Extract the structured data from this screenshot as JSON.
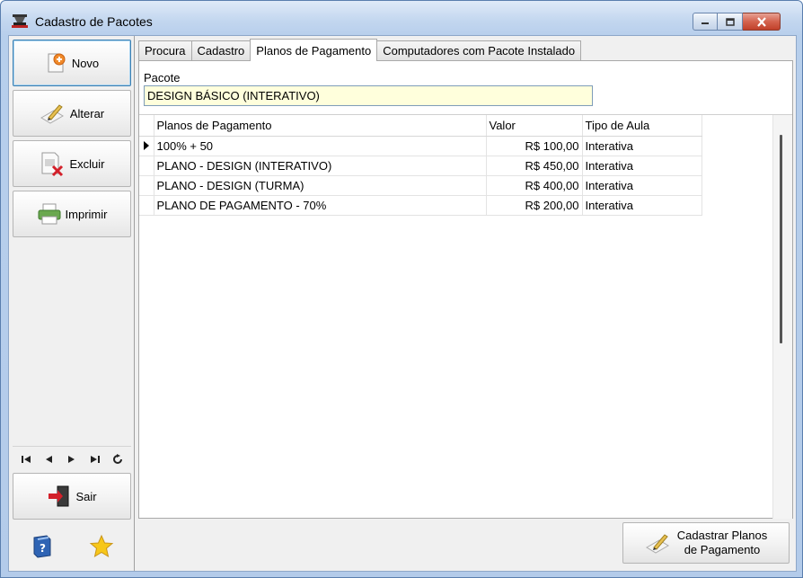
{
  "window": {
    "title": "Cadastro de Pacotes"
  },
  "sidebar": {
    "buttons": [
      {
        "label": "Novo",
        "icon": "new-document-icon"
      },
      {
        "label": "Alterar",
        "icon": "edit-pen-icon"
      },
      {
        "label": "Excluir",
        "icon": "delete-document-icon"
      },
      {
        "label": "Imprimir",
        "icon": "printer-icon"
      }
    ],
    "exit_label": "Sair",
    "nav_icons": [
      "first-record-icon",
      "previous-record-icon",
      "next-record-icon",
      "last-record-icon",
      "refresh-icon"
    ],
    "bottom_icons": [
      "help-book-icon",
      "favorite-star-icon"
    ]
  },
  "tabs": [
    {
      "label": "Procura"
    },
    {
      "label": "Cadastro"
    },
    {
      "label": "Planos de Pagamento",
      "selected": true
    },
    {
      "label": "Computadores com Pacote Instalado"
    }
  ],
  "form": {
    "pacote_label": "Pacote",
    "pacote_value": "DESIGN BÁSICO (INTERATIVO)"
  },
  "grid": {
    "columns": [
      "Planos de Pagamento",
      "Valor",
      "Tipo de Aula"
    ],
    "rows": [
      {
        "plano": "100% + 50",
        "valor": "R$ 100,00",
        "tipo": "Interativa",
        "current": true
      },
      {
        "plano": "PLANO - DESIGN (INTERATIVO)",
        "valor": "R$ 450,00",
        "tipo": "Interativa"
      },
      {
        "plano": "PLANO - DESIGN (TURMA)",
        "valor": "R$ 400,00",
        "tipo": "Interativa"
      },
      {
        "plano": "PLANO DE PAGAMENTO - 70%",
        "valor": "R$ 200,00",
        "tipo": "Interativa"
      }
    ]
  },
  "action_button": {
    "line1": "Cadastrar Planos",
    "line2": "de Pagamento"
  },
  "colors": {
    "field_background": "#ffffdc",
    "close_button": "#d4634e"
  }
}
